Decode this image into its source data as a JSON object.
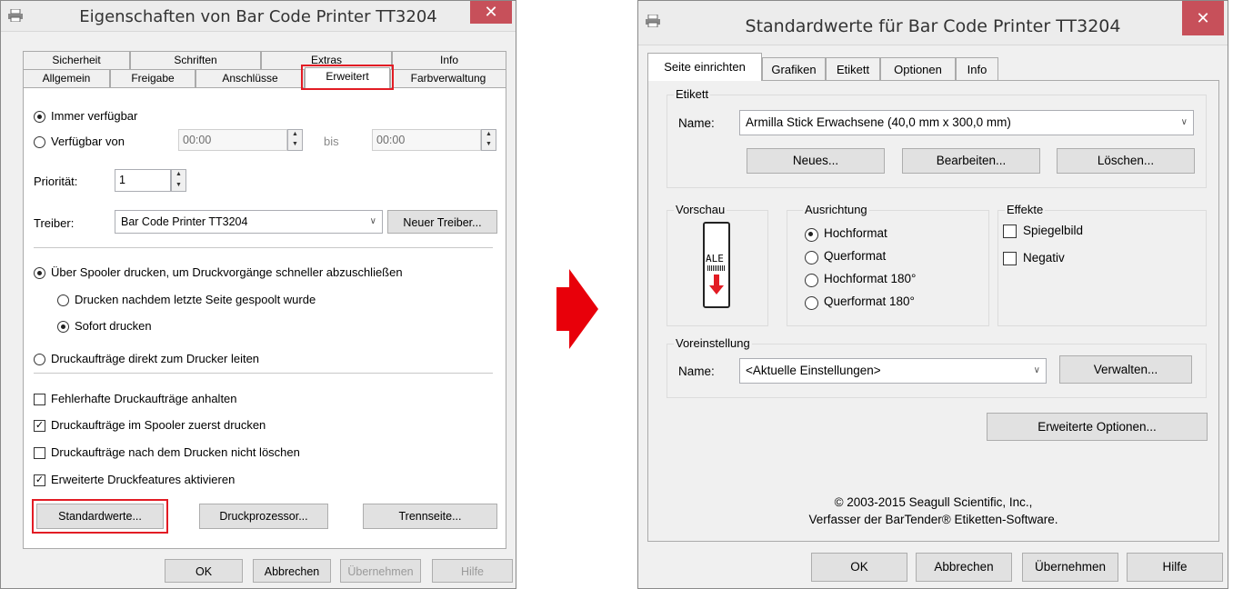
{
  "left_dialog": {
    "title": "Eigenschaften von Bar Code Printer TT3204",
    "close": "✕",
    "tabs_row1": [
      "Sicherheit",
      "Schriften",
      "Extras",
      "Info"
    ],
    "tabs_row2": [
      "Allgemein",
      "Freigabe",
      "Anschlüsse",
      "Erweitert",
      "Farbverwaltung"
    ],
    "always_available": "Immer verfügbar",
    "available_from": "Verfügbar von",
    "time_from": "00:00",
    "to_label": "bis",
    "time_to": "00:00",
    "priority_label": "Priorität:",
    "priority_value": "1",
    "driver_label": "Treiber:",
    "driver_value": "Bar Code Printer TT3204",
    "new_driver_button": "Neuer Treiber...",
    "spool_option": "Über Spooler drucken, um Druckvorgänge schneller abzuschließen",
    "spool_after_last": "Drucken nachdem letzte Seite gespoolt wurde",
    "spool_immediately": "Sofort drucken",
    "direct_print": "Druckaufträge direkt zum Drucker leiten",
    "hold_mismatched": "Fehlerhafte Druckaufträge anhalten",
    "spooled_first": "Druckaufträge im Spooler zuerst drucken",
    "keep_printed": "Druckaufträge nach dem Drucken nicht löschen",
    "advanced_features": "Erweiterte Druckfeatures aktivieren",
    "defaults_button": "Standardwerte...",
    "print_processor_button": "Druckprozessor...",
    "separator_page_button": "Trennseite...",
    "ok_button": "OK",
    "cancel_button": "Abbrechen",
    "apply_button": "Übernehmen",
    "help_button": "Hilfe"
  },
  "right_dialog": {
    "title": "Standardwerte für Bar Code Printer TT3204",
    "close": "✕",
    "tabs": [
      "Seite einrichten",
      "Grafiken",
      "Etikett",
      "Optionen",
      "Info"
    ],
    "label_group": "Etikett",
    "name_label": "Name:",
    "label_name_value": "Armilla Stick Erwachsene (40,0 mm x 300,0 mm)",
    "new_button": "Neues...",
    "edit_button": "Bearbeiten...",
    "delete_button": "Löschen...",
    "preview_group": "Vorschau",
    "preview_text": "ALE",
    "orientation_group": "Ausrichtung",
    "portrait": "Hochformat",
    "landscape": "Querformat",
    "portrait_180": "Hochformat 180°",
    "landscape_180": "Querformat 180°",
    "effects_group": "Effekte",
    "mirror": "Spiegelbild",
    "negative": "Negativ",
    "preset_group": "Voreinstellung",
    "preset_name_label": "Name:",
    "preset_value": "<Aktuelle Einstellungen>",
    "manage_button": "Verwalten...",
    "advanced_options_button": "Erweiterte Optionen...",
    "copyright": "© 2003-2015 Seagull Scientific, Inc.,",
    "author": "Verfasser der BarTender® Etiketten-Software.",
    "ok_button": "OK",
    "cancel_button": "Abbrechen",
    "apply_button": "Übernehmen",
    "help_button": "Hilfe"
  },
  "colors": {
    "highlight": "#e21c24",
    "arrow": "#e8000a",
    "close_button": "#c7505a"
  }
}
